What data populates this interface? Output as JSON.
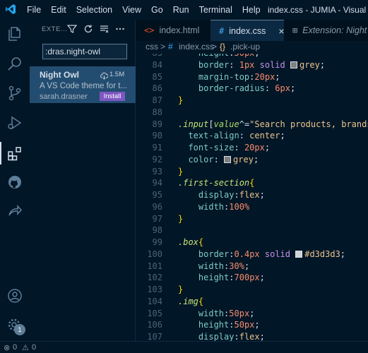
{
  "menu": [
    "File",
    "Edit",
    "Selection",
    "View",
    "Go",
    "Run",
    "Terminal",
    "Help"
  ],
  "window_title": "index.css - JUMIA - Visual Studio Code",
  "activity_bar": [
    "explorer-icon",
    "search-icon",
    "source-control-icon",
    "run-debug-icon",
    "extensions-icon",
    "github-icon",
    "live-share-icon",
    "account-icon",
    "settings-gear-icon"
  ],
  "settings_badge": "1",
  "sidebar": {
    "title": "EXTE...",
    "search_value": ":dras.night-owl",
    "extension": {
      "name": "Night Owl",
      "downloads": "1.5M",
      "description": "A VS Code theme for t...",
      "author": "sarah.drasner",
      "install_label": "Install"
    }
  },
  "tabs": [
    {
      "icon": "<>",
      "label": "index.html"
    },
    {
      "icon": "#",
      "label": "index.css",
      "close": "×"
    },
    {
      "icon": "⊞",
      "label": "Extension: Night O"
    }
  ],
  "breadcrumb": {
    "part1": "css",
    "sep": ">",
    "icon": "#",
    "part2": "index.css",
    "part3": ".pick-up"
  },
  "code_lines": [
    {
      "n": "83",
      "segs": [
        [
          "    ",
          "t-punc"
        ],
        [
          "height",
          "t-prop"
        ],
        [
          ":",
          "t-punc"
        ],
        [
          "50",
          "t-num"
        ],
        [
          "px",
          "t-unit"
        ],
        [
          ";",
          "t-punc"
        ]
      ]
    },
    {
      "n": "84",
      "segs": [
        [
          "    ",
          "t-punc"
        ],
        [
          "border",
          "t-prop"
        ],
        [
          ": ",
          "t-punc"
        ],
        [
          "1",
          "t-num"
        ],
        [
          "px",
          "t-unit"
        ],
        [
          " solid ",
          "t-kw"
        ],
        [
          "__sw:#808080",
          ""
        ],
        [
          "grey",
          "t-str"
        ],
        [
          ";",
          "t-punc"
        ]
      ]
    },
    {
      "n": "85",
      "segs": [
        [
          "    ",
          "t-punc"
        ],
        [
          "margin-top",
          "t-prop"
        ],
        [
          ":",
          "t-punc"
        ],
        [
          "20",
          "t-num"
        ],
        [
          "px",
          "t-unit"
        ],
        [
          ";",
          "t-punc"
        ]
      ]
    },
    {
      "n": "86",
      "segs": [
        [
          "    ",
          "t-punc"
        ],
        [
          "border-radius",
          "t-prop"
        ],
        [
          ": ",
          "t-punc"
        ],
        [
          "6",
          "t-num"
        ],
        [
          "px",
          "t-unit"
        ],
        [
          ";",
          "t-punc"
        ]
      ]
    },
    {
      "n": "87",
      "segs": [
        [
          "}",
          "t-brace"
        ]
      ]
    },
    {
      "n": "88",
      "segs": []
    },
    {
      "n": "89",
      "segs": [
        [
          ".input",
          "t-selI"
        ],
        [
          "[",
          "t-punc"
        ],
        [
          "value",
          "t-attr"
        ],
        [
          "^=",
          "t-punc"
        ],
        [
          "\"Search products, brands a",
          "t-str"
        ]
      ]
    },
    {
      "n": "90",
      "segs": [
        [
          "  ",
          "t-punc"
        ],
        [
          "text-align",
          "t-prop"
        ],
        [
          ": ",
          "t-punc"
        ],
        [
          "center",
          "t-str"
        ],
        [
          ";",
          "t-punc"
        ]
      ]
    },
    {
      "n": "91",
      "segs": [
        [
          "  ",
          "t-punc"
        ],
        [
          "font-size",
          "t-prop"
        ],
        [
          ": ",
          "t-punc"
        ],
        [
          "20",
          "t-num"
        ],
        [
          "px",
          "t-unit"
        ],
        [
          ";",
          "t-punc"
        ]
      ]
    },
    {
      "n": "92",
      "segs": [
        [
          "  ",
          "t-punc"
        ],
        [
          "color",
          "t-prop"
        ],
        [
          ": ",
          "t-punc"
        ],
        [
          "__sw:#808080",
          ""
        ],
        [
          "grey",
          "t-str"
        ],
        [
          ";",
          "t-punc"
        ]
      ]
    },
    {
      "n": "93",
      "segs": [
        [
          "}",
          "t-brace"
        ]
      ]
    },
    {
      "n": "94",
      "segs": [
        [
          ".first-section",
          "t-selI"
        ],
        [
          "{",
          "t-brace"
        ]
      ]
    },
    {
      "n": "95",
      "segs": [
        [
          "    ",
          "t-punc"
        ],
        [
          "display",
          "t-prop"
        ],
        [
          ":",
          "t-punc"
        ],
        [
          "flex",
          "t-str"
        ],
        [
          ";",
          "t-punc"
        ]
      ]
    },
    {
      "n": "96",
      "segs": [
        [
          "    ",
          "t-punc"
        ],
        [
          "width",
          "t-prop"
        ],
        [
          ":",
          "t-punc"
        ],
        [
          "100",
          "t-num"
        ],
        [
          "%",
          "t-unit"
        ]
      ]
    },
    {
      "n": "97",
      "segs": [
        [
          "}",
          "t-brace"
        ]
      ]
    },
    {
      "n": "98",
      "segs": []
    },
    {
      "n": "99",
      "segs": [
        [
          ".box",
          "t-selI"
        ],
        [
          "{",
          "t-brace"
        ]
      ]
    },
    {
      "n": "100",
      "segs": [
        [
          "    ",
          "t-punc"
        ],
        [
          "border",
          "t-prop"
        ],
        [
          ":",
          "t-punc"
        ],
        [
          "0.4",
          "t-num"
        ],
        [
          "px",
          "t-unit"
        ],
        [
          " solid ",
          "t-kw"
        ],
        [
          "__sw:#d3d3d3",
          ""
        ],
        [
          "#d3d3d3",
          "t-str"
        ],
        [
          ";",
          "t-punc"
        ]
      ]
    },
    {
      "n": "101",
      "segs": [
        [
          "    ",
          "t-punc"
        ],
        [
          "width",
          "t-prop"
        ],
        [
          ":",
          "t-punc"
        ],
        [
          "30",
          "t-num"
        ],
        [
          "%",
          "t-unit"
        ],
        [
          ";",
          "t-punc"
        ]
      ]
    },
    {
      "n": "102",
      "segs": [
        [
          "    ",
          "t-punc"
        ],
        [
          "height",
          "t-prop"
        ],
        [
          ":",
          "t-punc"
        ],
        [
          "700",
          "t-num"
        ],
        [
          "px",
          "t-unit"
        ],
        [
          ";",
          "t-punc"
        ]
      ]
    },
    {
      "n": "103",
      "segs": [
        [
          "}",
          "t-brace"
        ]
      ]
    },
    {
      "n": "104",
      "segs": [
        [
          ".img",
          "t-selI"
        ],
        [
          "{",
          "t-brace"
        ]
      ]
    },
    {
      "n": "105",
      "segs": [
        [
          "    ",
          "t-punc"
        ],
        [
          "width",
          "t-prop"
        ],
        [
          ":",
          "t-punc"
        ],
        [
          "50",
          "t-num"
        ],
        [
          "px",
          "t-unit"
        ],
        [
          ";",
          "t-punc"
        ]
      ]
    },
    {
      "n": "106",
      "segs": [
        [
          "    ",
          "t-punc"
        ],
        [
          "height",
          "t-prop"
        ],
        [
          ":",
          "t-punc"
        ],
        [
          "50",
          "t-num"
        ],
        [
          "px",
          "t-unit"
        ],
        [
          ";",
          "t-punc"
        ]
      ]
    },
    {
      "n": "107",
      "segs": [
        [
          "    ",
          "t-punc"
        ],
        [
          "display",
          "t-prop"
        ],
        [
          ":",
          "t-punc"
        ],
        [
          "flex",
          "t-str"
        ],
        [
          ";",
          "t-punc"
        ]
      ]
    }
  ],
  "status": {
    "errors": "0",
    "warnings": "0"
  },
  "colors": {
    "background": "#011627",
    "active_tab": "#0b2942",
    "install_button": "#7e57c2",
    "selected_item": "#234d70"
  }
}
